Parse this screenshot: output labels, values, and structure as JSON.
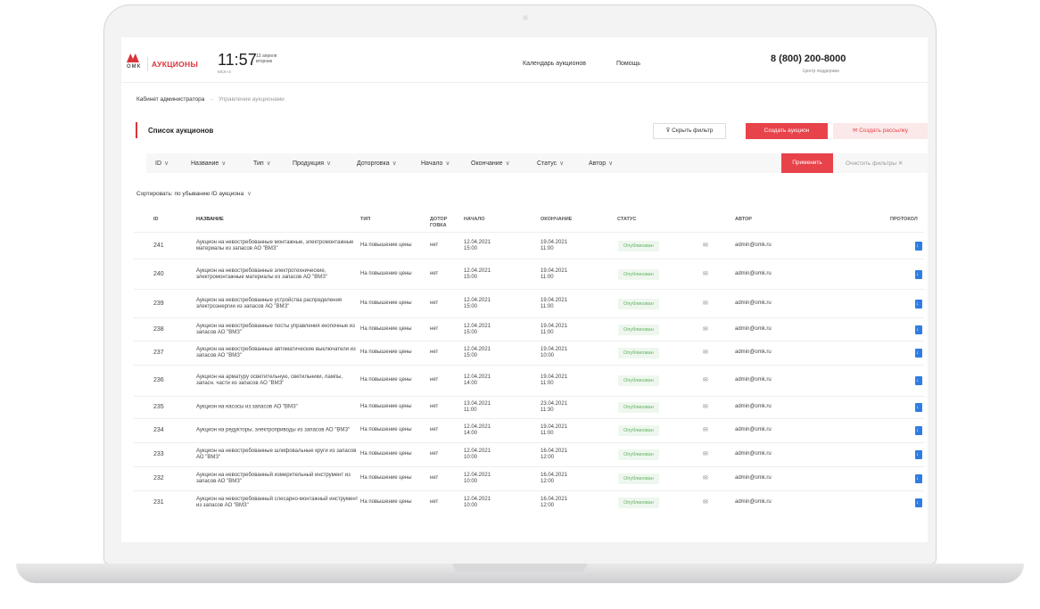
{
  "header": {
    "logo_text": "ОМК",
    "brand": "АУКЦИОНЫ",
    "time": "11:57",
    "timezone": "МСК+3",
    "date_day": "13 апреля",
    "date_weekday": "вторник",
    "nav": [
      "Календарь аукционов",
      "Помощь"
    ],
    "phone": "8 (800) 200-8000",
    "phone_caption": "Центр поддержки"
  },
  "breadcrumb": [
    "Кабинет администратора",
    "Управление аукционами"
  ],
  "breadcrumb_sep": "–",
  "page": {
    "title": "Список аукционов",
    "hide_filter": "Скрыть фильтр",
    "create_auction": "Создать аукцион",
    "create_mailing": "Создать рассылку"
  },
  "filters": {
    "items": [
      "ID",
      "Название",
      "Тип",
      "Продукция",
      "Доторговка",
      "Начало",
      "Окончание",
      "Статус",
      "Автор"
    ],
    "apply": "Применить",
    "clear": "Очистить фильтры",
    "clear_icon": "✕"
  },
  "sort": {
    "label": "Сортировать:",
    "value": "по убыванию ID аукциона"
  },
  "table": {
    "columns": {
      "id": "ID",
      "name": "НАЗВАНИЕ",
      "type": "ТИП",
      "dotorgovka": "ДОТОР ГОВКА",
      "start": "НАЧАЛО",
      "end": "ОКОНЧАНИЕ",
      "status": "СТАТУС",
      "author": "АВТОР",
      "protocol": "ПРОТОКОЛ"
    },
    "rows": [
      {
        "id": "241",
        "name": "Аукцион на невостребованные монтажные, электромонтажные материалы из запасов АО \"ВМЗ\"",
        "type": "На повышение цены",
        "dot": "нет",
        "start_d": "12.04.2021",
        "start_t": "15:00",
        "end_d": "19.04.2021",
        "end_t": "11:00",
        "status": "Опубликован",
        "author": "admin@omk.ru"
      },
      {
        "id": "240",
        "name": "Аукцион на невостребованные электротехнические, электромонтажные материалы из запасов АО \"ВМЗ\"",
        "type": "На повышение цены",
        "dot": "нет",
        "start_d": "12.04.2021",
        "start_t": "15:00",
        "end_d": "19.04.2021",
        "end_t": "11:00",
        "status": "Опубликован",
        "author": "admin@omk.ru"
      },
      {
        "id": "239",
        "name": "Аукцион на невостребованные устройства распределения электроэнергии из запасов АО \"ВМЗ\"",
        "type": "На повышение цены",
        "dot": "нет",
        "start_d": "12.04.2021",
        "start_t": "15:00",
        "end_d": "19.04.2021",
        "end_t": "11:00",
        "status": "Опубликован",
        "author": "admin@omk.ru"
      },
      {
        "id": "238",
        "name": "Аукцион на невостребованные посты управления кнопочные из запасов АО \"ВМЗ\"",
        "type": "На повышение цены",
        "dot": "нет",
        "start_d": "12.04.2021",
        "start_t": "15:00",
        "end_d": "19.04.2021",
        "end_t": "11:00",
        "status": "Опубликован",
        "author": "admin@omk.ru"
      },
      {
        "id": "237",
        "name": "Аукцион на невостребованные автоматические выключатели из запасов АО \"ВМЗ\"",
        "type": "На повышение цены",
        "dot": "нет",
        "start_d": "12.04.2021",
        "start_t": "15:00",
        "end_d": "19.04.2021",
        "end_t": "10:00",
        "status": "Опубликован",
        "author": "admin@omk.ru"
      },
      {
        "id": "236",
        "name": "Аукцион на арматуру осветительную, светильники, лампы, запасн. части из запасов АО \"ВМЗ\"",
        "type": "На повышение цены",
        "dot": "нет",
        "start_d": "12.04.2021",
        "start_t": "14:00",
        "end_d": "19.04.2021",
        "end_t": "11:00",
        "status": "Опубликован",
        "author": "admin@omk.ru"
      },
      {
        "id": "235",
        "name": "Аукцион на насосы из запасов АО \"ВМЗ\"",
        "type": "На повышение цены",
        "dot": "нет",
        "start_d": "13.04.2021",
        "start_t": "11:00",
        "end_d": "23.04.2021",
        "end_t": "11:30",
        "status": "Опубликован",
        "author": "admin@omk.ru"
      },
      {
        "id": "234",
        "name": "Аукцион на редукторы, электроприводы из запасов АО \"ВМЗ\"",
        "type": "На повышение цены",
        "dot": "нет",
        "start_d": "12.04.2021",
        "start_t": "14:00",
        "end_d": "19.04.2021",
        "end_t": "11:00",
        "status": "Опубликован",
        "author": "admin@omk.ru"
      },
      {
        "id": "233",
        "name": "Аукцион на невостребованные шлифовальные круги из запасов АО \"ВМЗ\"",
        "type": "На повышение цены",
        "dot": "нет",
        "start_d": "12.04.2021",
        "start_t": "10:00",
        "end_d": "16.04.2021",
        "end_t": "12:00",
        "status": "Опубликован",
        "author": "admin@omk.ru"
      },
      {
        "id": "232",
        "name": "Аукцион на невостребованный измерительный инструмент из запасов АО \"ВМЗ\"",
        "type": "На повышение цены",
        "dot": "нет",
        "start_d": "12.04.2021",
        "start_t": "10:00",
        "end_d": "16.04.2021",
        "end_t": "12:00",
        "status": "Опубликован",
        "author": "admin@omk.ru"
      },
      {
        "id": "231",
        "name": "Аукцион на невостребованный слесарно-монтажный инструмент из запасов АО \"ВМЗ\"",
        "type": "На повышение цены",
        "dot": "нет",
        "start_d": "12.04.2021",
        "start_t": "10:00",
        "end_d": "16.04.2021",
        "end_t": "12:00",
        "status": "Опубликован",
        "author": "admin@omk.ru"
      }
    ]
  },
  "colors": {
    "accent": "#e8434a",
    "status_bg": "#eef7ee",
    "status_text": "#64b364",
    "doc_icon": "#2f7de1"
  }
}
